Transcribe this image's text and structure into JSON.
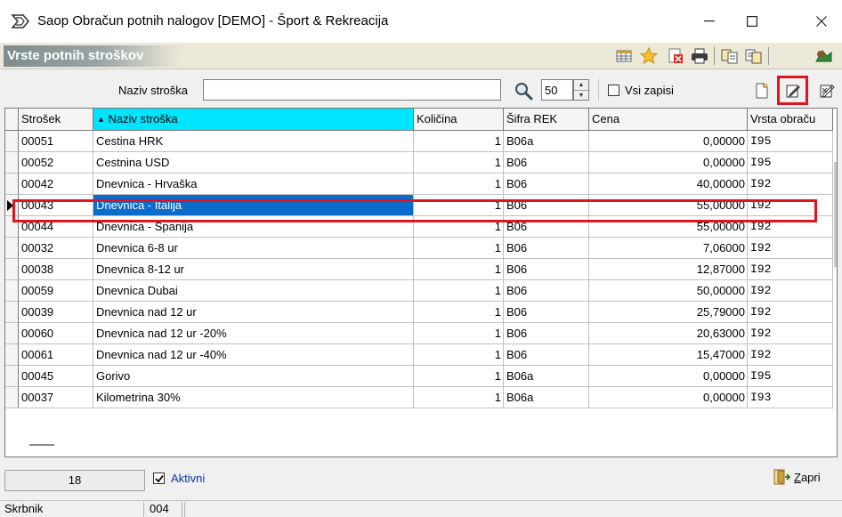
{
  "window": {
    "title": "Saop Obračun potnih nalogov [DEMO] - Šport & Rekreacija",
    "minimize_glyph": "—",
    "close_glyph": "×"
  },
  "header": {
    "title": "Vrste potnih stroškov",
    "toolbar_icons": [
      "table-icon",
      "star-icon",
      "delete-icon",
      "print-icon",
      "copy-icon",
      "paste-icon",
      "export-icon"
    ]
  },
  "search": {
    "label": "Naziv stroška",
    "value": "",
    "page_size": "50",
    "all_records_label": "Vsi zapisi",
    "all_records_checked": false,
    "actions": [
      "new-record-icon",
      "edit-record-icon",
      "edit-multiple-icon"
    ]
  },
  "grid": {
    "columns": [
      "Strošek",
      "Naziv stroška",
      "Količina",
      "Šifra REK",
      "Cena",
      "Vrsta obraču"
    ],
    "sorted_column": "Naziv stroška",
    "selected_row": 3,
    "rows": [
      {
        "code": "00051",
        "name": "Cestina HRK",
        "qty": "1",
        "rek": "B06a",
        "price": "0,00000",
        "type": "I95"
      },
      {
        "code": "00052",
        "name": "Cestnina USD",
        "qty": "1",
        "rek": "B06",
        "price": "0,00000",
        "type": "I95"
      },
      {
        "code": "00042",
        "name": "Dnevnica - Hrvaška",
        "qty": "1",
        "rek": "B06",
        "price": "40,00000",
        "type": "I92"
      },
      {
        "code": "00043",
        "name": "Dnevnica - Italija",
        "qty": "1",
        "rek": "B06",
        "price": "55,00000",
        "type": "I92"
      },
      {
        "code": "00044",
        "name": "Dnevnica - Španija",
        "qty": "1",
        "rek": "B06",
        "price": "55,00000",
        "type": "I92"
      },
      {
        "code": "00032",
        "name": "Dnevnica 6-8 ur",
        "qty": "1",
        "rek": "B06",
        "price": "7,06000",
        "type": "I92"
      },
      {
        "code": "00038",
        "name": "Dnevnica 8-12 ur",
        "qty": "1",
        "rek": "B06",
        "price": "12,87000",
        "type": "I92"
      },
      {
        "code": "00059",
        "name": "Dnevnica Dubai",
        "qty": "1",
        "rek": "B06",
        "price": "50,00000",
        "type": "I92"
      },
      {
        "code": "00039",
        "name": "Dnevnica nad 12 ur",
        "qty": "1",
        "rek": "B06",
        "price": "25,79000",
        "type": "I92"
      },
      {
        "code": "00060",
        "name": "Dnevnica nad 12 ur -20%",
        "qty": "1",
        "rek": "B06",
        "price": "20,63000",
        "type": "I92"
      },
      {
        "code": "00061",
        "name": "Dnevnica nad 12 ur -40%",
        "qty": "1",
        "rek": "B06",
        "price": "15,47000",
        "type": "I92"
      },
      {
        "code": "00045",
        "name": "Gorivo",
        "qty": "1",
        "rek": "B06a",
        "price": "0,00000",
        "type": "I95"
      },
      {
        "code": "00037",
        "name": "Kilometrina 30%",
        "qty": "1",
        "rek": "B06a",
        "price": "0,00000",
        "type": "I93"
      }
    ]
  },
  "footer": {
    "record_count": "18",
    "active_label": "Aktivni",
    "active_checked": true,
    "close_label_first": "Z",
    "close_label_rest": "apri"
  },
  "status_bar": {
    "label": "Skrbnik",
    "value": "004"
  },
  "colors": {
    "selection": "#0c6ccc",
    "sorted_header": "#00e5ff",
    "highlight_annotation": "#e0141e"
  }
}
